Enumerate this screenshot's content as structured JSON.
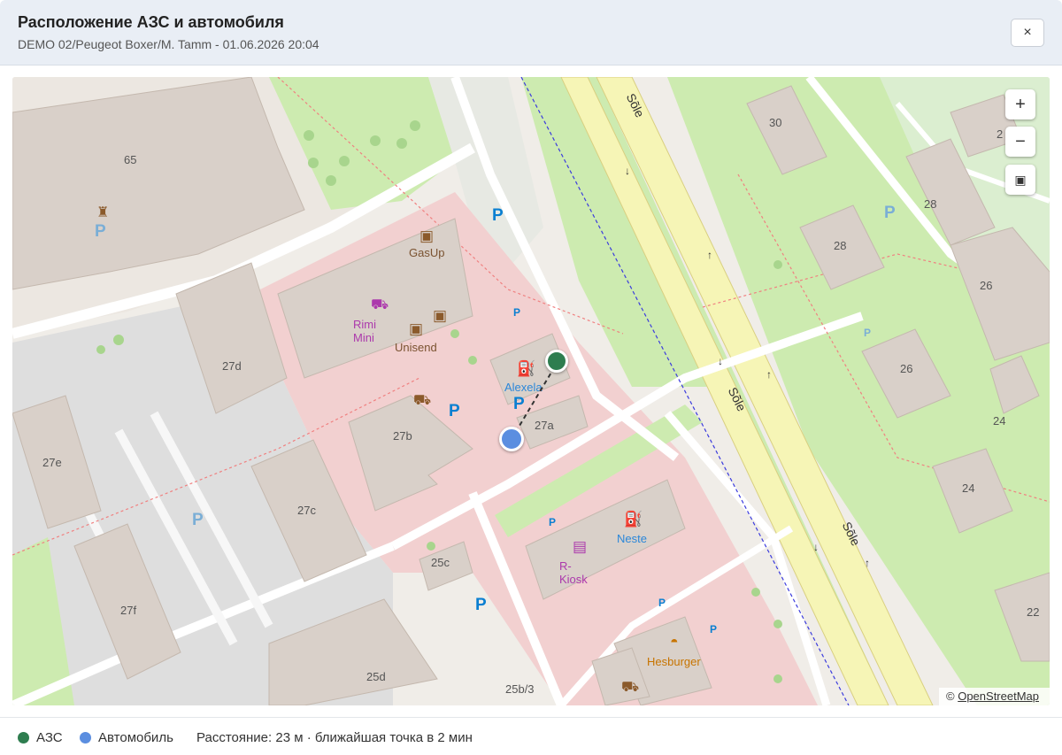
{
  "dialog": {
    "title": "Расположение АЗС и автомобиля",
    "subtitle": "DEMO 02/Peugeot Boxer/M. Tamm - 01.06.2026 20:04",
    "close_label": "×"
  },
  "map": {
    "controls": {
      "zoom_in": "+",
      "zoom_out": "−",
      "fit": "▣"
    },
    "attribution": {
      "prefix": "©",
      "link": "OpenStreetMap"
    },
    "labels": {
      "b65": "65",
      "b30": "30",
      "b2": "2",
      "b28a": "28",
      "b28b": "28",
      "b26a": "26",
      "b26b": "26",
      "b24a": "24",
      "b24b": "24",
      "b22": "22",
      "b27d": "27d",
      "b27b": "27b",
      "b27a": "27a",
      "b27e": "27e",
      "b27c": "27c",
      "b27f": "27f",
      "b25c": "25c",
      "b25d": "25d",
      "b25b3": "25b/3",
      "gasup": "GasUp",
      "rimi": "Rimi Mini",
      "unisend": "Unisend",
      "alexela": "Alexela",
      "neste": "Neste",
      "rkiosk": "R-Kiosk",
      "hesburger": "Hesburger",
      "road1": "Sõle",
      "road2": "Sõle",
      "road3": "Sõle",
      "parking": "P"
    },
    "colors": {
      "station": "#2e7d4f",
      "vehicle": "#5b8ee0"
    }
  },
  "footer": {
    "station_label": "АЗС",
    "vehicle_label": "Автомобиль",
    "distance_text": "Расстояние: 23 м · ближайшая точка в 2 мин"
  }
}
